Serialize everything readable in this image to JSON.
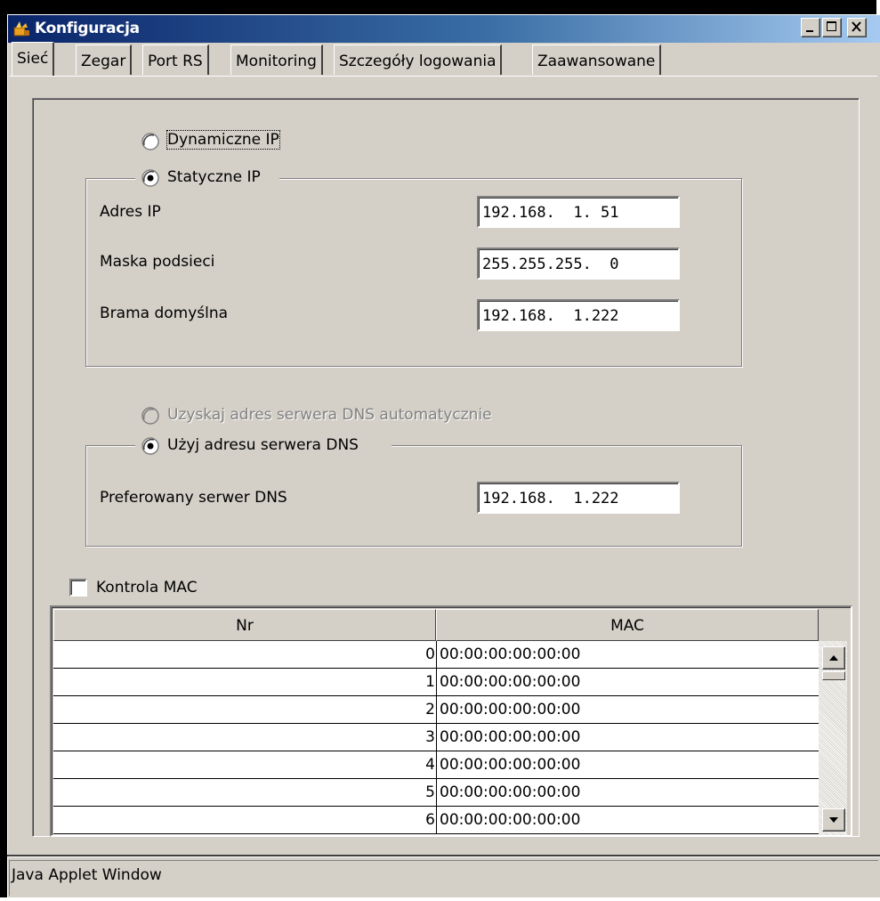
{
  "window": {
    "title": "Konfiguracja",
    "status": "Java Applet Window"
  },
  "tabs": [
    {
      "label": "Sieć",
      "active": true
    },
    {
      "label": "Zegar"
    },
    {
      "label": "Port RS"
    },
    {
      "label": "Monitoring"
    },
    {
      "label": "Szczegóły logowania"
    },
    {
      "label": "Zaawansowane"
    }
  ],
  "ip_mode": {
    "dynamic_label": "Dynamiczne IP",
    "static_label": "Statyczne IP",
    "selected": "static"
  },
  "static_ip": {
    "address_label": "Adres IP",
    "address_value": "192.168.  1. 51",
    "mask_label": "Maska podsieci",
    "mask_value": "255.255.255.  0",
    "gateway_label": "Brama domyślna",
    "gateway_value": "192.168.  1.222"
  },
  "dns_mode": {
    "auto_label": "Uzyskaj adres serwera DNS automatycznie",
    "manual_label": "Użyj adresu serwera DNS",
    "selected": "manual"
  },
  "dns": {
    "preferred_label": "Preferowany serwer DNS",
    "preferred_value": "192.168.  1.222"
  },
  "mac_control": {
    "label": "Kontrola MAC",
    "checked": false
  },
  "mac_table": {
    "columns": [
      "Nr",
      "MAC"
    ],
    "rows": [
      {
        "nr": "0",
        "mac": "00:00:00:00:00:00"
      },
      {
        "nr": "1",
        "mac": "00:00:00:00:00:00"
      },
      {
        "nr": "2",
        "mac": "00:00:00:00:00:00"
      },
      {
        "nr": "3",
        "mac": "00:00:00:00:00:00"
      },
      {
        "nr": "4",
        "mac": "00:00:00:00:00:00"
      },
      {
        "nr": "5",
        "mac": "00:00:00:00:00:00"
      },
      {
        "nr": "6",
        "mac": "00:00:00:00:00:00"
      }
    ]
  }
}
